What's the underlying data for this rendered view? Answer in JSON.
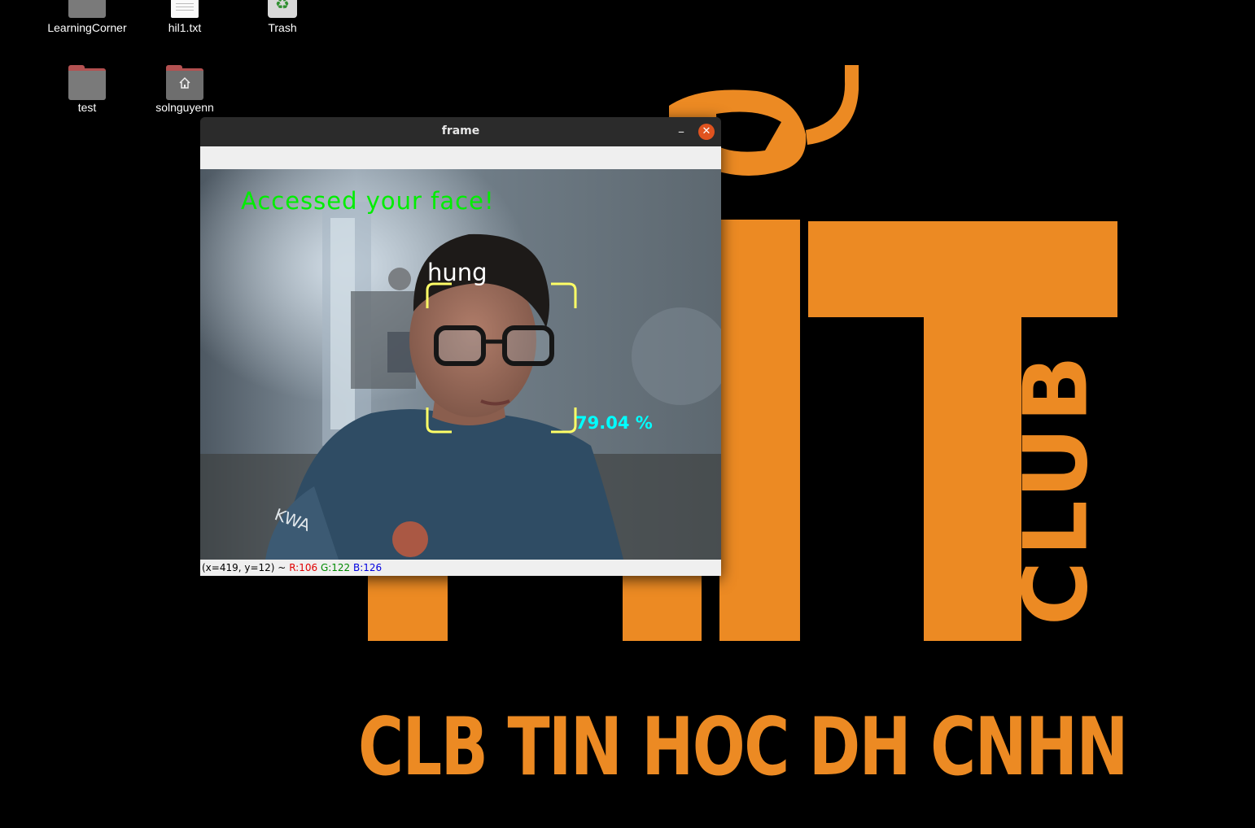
{
  "wallpaper": {
    "brand_color": "#ec8a23",
    "logo_letters": "IT",
    "club_label": "CLUB",
    "caption": "CLB TIN HOC DH CNHN"
  },
  "desktop": {
    "icons": [
      {
        "label": "LearningCorner",
        "icon": "folder-icon"
      },
      {
        "label": "hil1.txt",
        "icon": "text-file-icon"
      },
      {
        "label": "Trash",
        "icon": "trash-icon"
      },
      {
        "label": "test",
        "icon": "folder-icon"
      },
      {
        "label": "solnguyenn",
        "icon": "home-folder-icon"
      }
    ]
  },
  "window": {
    "title": "frame",
    "minimize_symbol": "–",
    "close_symbol": "✕",
    "overlay": {
      "status_message": "Accessed your face!",
      "person_name": "hung",
      "confidence": "79.04 %",
      "status_color": "#00ee00",
      "name_color": "#ffffff",
      "confidence_color": "#00ffff",
      "box_color": "#ffff66"
    },
    "statusbar": {
      "coords": "(x=419, y=12) ~",
      "r": "R:106",
      "g": "G:122",
      "b": "B:126"
    }
  }
}
